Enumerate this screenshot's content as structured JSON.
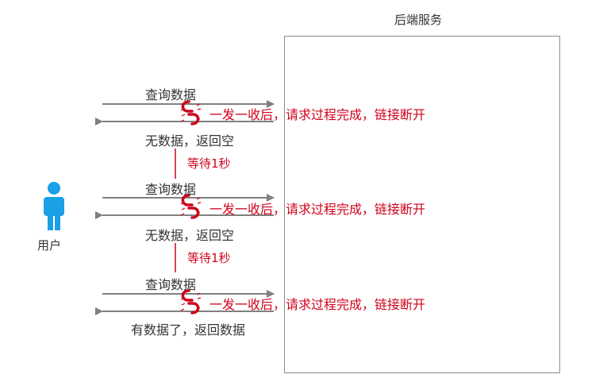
{
  "server": {
    "title": "后端服务"
  },
  "user": {
    "label": "用户"
  },
  "rounds": [
    {
      "request": "查询数据",
      "response": "无数据，返回空",
      "note": "一发一收后，请求过程完成，链接断开"
    },
    {
      "request": "查询数据",
      "response": "无数据，返回空",
      "note": "一发一收后，请求过程完成，链接断开"
    },
    {
      "request": "查询数据",
      "response": "有数据了，返回数据",
      "note": "一发一收后，请求过程完成，链接断开"
    }
  ],
  "waits": [
    {
      "label": "等待1秒"
    },
    {
      "label": "等待1秒"
    }
  ],
  "colors": {
    "accent": "#d0021b",
    "arrow": "#808080",
    "user": "#1aa0e6",
    "border": "#8c8c8c"
  },
  "icons": {
    "user": "person-icon",
    "broken": "broken-link-icon"
  }
}
